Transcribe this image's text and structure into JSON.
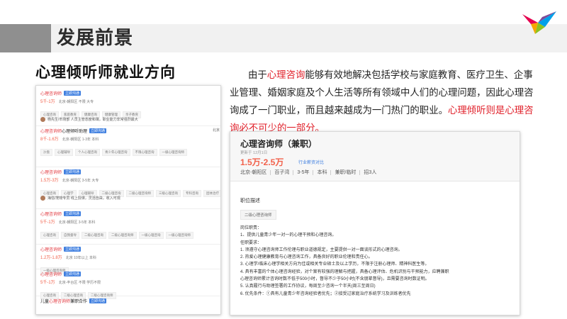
{
  "slide": {
    "title": "发展前景",
    "subtitle": "心理倾听师就业方向"
  },
  "intro": {
    "segments": [
      {
        "text": "由于",
        "red": false
      },
      {
        "text": "心理咨询",
        "red": true
      },
      {
        "text": "能够有效地解决包括学校与家庭教育、医疗卫生、企事业管理、婚姻家庭及个人生活等所有领域中人们的心理问题，因此心理咨询成了一门职业，而且越来越成为一门热门的职业。",
        "red": false
      },
      {
        "text": "心理倾听则是心理咨询必不可少的一部分。",
        "red": true
      }
    ]
  },
  "job_list": {
    "chat_label": "立即沟通",
    "jobs": [
      {
        "pre": "",
        "hl": "心理咨询师",
        "post": "",
        "salary": "5千-1万",
        "meta": "北京-朝阳区  不限  大专",
        "tags": [
          "心理咨询",
          "家庭教育",
          "健康咨询",
          "健康管理",
          "亲子教育"
        ],
        "recruiter": "杨先生/市场部  人员主管态度和蔼，职业能力非常强烈最大",
        "side": ""
      },
      {
        "pre": "",
        "hl": "心理咨询师",
        "post": "心理倾听助理",
        "salary": "8千-1.6万",
        "meta": "北京-朝阳区  1-3年  本科",
        "tags": [
          "沙盘",
          "心理辅导",
          "个人心理咨询",
          "青少年心理咨询",
          "不限心理咨询",
          "一级心理咨询师"
        ],
        "recruiter": "",
        "side": "北京"
      },
      {
        "pre": "",
        "hl": "心理咨询师",
        "post": "",
        "salary": "1.5万-3万",
        "meta": "北京-朝阳区  3-5年  大专",
        "tags": [
          "心理咨询",
          "心理学",
          "心理辅导",
          "二级心理咨询",
          "二级心理咨询师",
          "三级心理咨询",
          "专科咨询",
          "团体治疗"
        ],
        "recruiter": "海信/宠物专员  线上授课，灵活自由，收入可观",
        "side": ""
      },
      {
        "pre": "",
        "hl": "心理咨询师",
        "post": "",
        "salary": "5千-1万",
        "meta": "北京-朝阳区  3-5年  本科",
        "tags": [
          "心理咨询",
          "自我督导",
          "二级心理咨询",
          "二级心理咨询师",
          "一级心理咨询",
          "一级心理咨询师"
        ],
        "recruiter": "",
        "side": ""
      },
      {
        "pre": "",
        "hl": "心理咨询师",
        "post": "",
        "salary": "1.2万-1.8万",
        "meta": "北京  10年以上  本科",
        "tags": [
          "一级心理咨询师"
        ],
        "recruiter": "",
        "side": ""
      },
      {
        "pre": "",
        "hl": "心理咨询师",
        "post": "",
        "salary": "5千-1万",
        "meta": "北京-丰台区  不限  学历不限",
        "tags": [
          "心理咨询",
          "二级心理咨询",
          "二级心理咨询师"
        ],
        "recruiter": "",
        "side": ""
      },
      {
        "pre": "儿童",
        "hl": "心理咨询师",
        "post": "兼职合作",
        "salary": "",
        "meta": "",
        "tags": [],
        "recruiter": "",
        "side": ""
      }
    ]
  },
  "job_detail": {
    "title": "心理咨询师（兼职）",
    "date": "更新于 12月1日",
    "salary": "1.5万-2.5万",
    "link": "行业薪资对比",
    "meta": [
      "北京-朝阳区",
      "百子湾",
      "3-5年",
      "本科",
      "兼职/临时",
      "招3人"
    ],
    "desc_heading": "职位描述",
    "desc_tag": "二级心理咨询师",
    "desc_lines": [
      "岗位职责：",
      "1、提供儿童青少年一对一的心理干预和心理咨询。",
      "任职要求：",
      "1. 须遵守心理咨询师工作伦理与职业道德规定，主要提供一对一面谈形式的心理咨询。",
      "2. 热爱心理健康教育与心理咨询工作，具备良好的职业伦理和责任心。",
      "3. 心理学/临床心理学相关方向为佳或相关专业硕士及以上学历，不限于注册心理师、精神科医生等。",
      "4. 具有丰富的个体心理咨询经验，对个案有较强的理解与把握，具备心理评估、危机识别与干预能力，应聘兼职",
      "心理咨询师累计咨询时数不低于500小时，督导不少于50小时(不含朋辈督导)，且需要咨询时数证明。",
      "5. 认真履行与助理签署的工作协议，每周至少咨询一个半天(周三至周日)",
      "6. 优先条件：①具有儿童青少年咨询经验者优先；②接受过家庭治疗系统学习及训练者优先"
    ]
  }
}
